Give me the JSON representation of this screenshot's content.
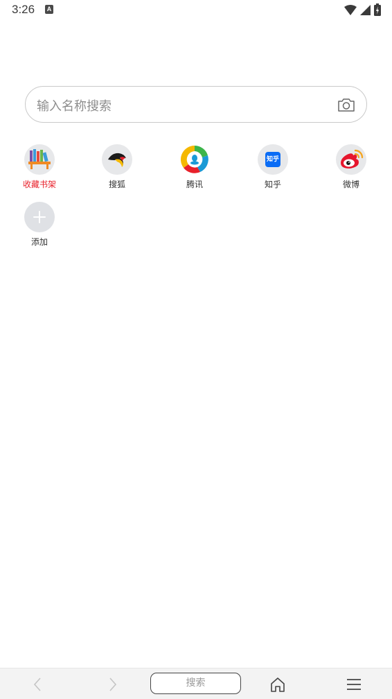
{
  "status": {
    "time": "3:26",
    "badge": "A"
  },
  "search": {
    "placeholder": "输入名称搜索"
  },
  "shortcuts": [
    {
      "label": "收藏书架",
      "color": "#e8202a"
    },
    {
      "label": "搜狐"
    },
    {
      "label": "腾讯"
    },
    {
      "label": "知乎",
      "icon_text": "知乎"
    },
    {
      "label": "微博"
    },
    {
      "label": "添加"
    }
  ],
  "bottom_bar": {
    "search_label": "搜索"
  },
  "colors": {
    "accent_red": "#e8202a",
    "zhihu_blue": "#0a6cf5",
    "bottom_bg": "#f3f3f3"
  }
}
